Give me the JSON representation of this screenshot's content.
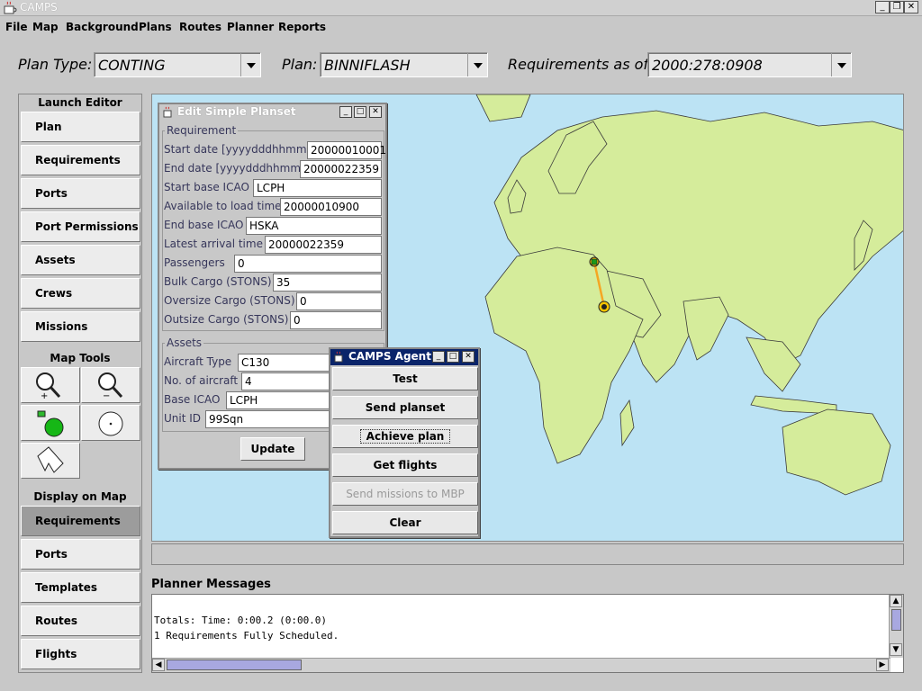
{
  "window": {
    "title": "CAMPS"
  },
  "menubar": {
    "items": [
      "File",
      "Map",
      "Background",
      "Plans",
      "Routes",
      "Planner",
      "Reports"
    ]
  },
  "selectors": {
    "plan_type": {
      "label": "Plan Type:",
      "value": "CONTING"
    },
    "plan": {
      "label": "Plan:",
      "value": "BINNIFLASH"
    },
    "requirements_as_of": {
      "label": "Requirements as of:",
      "value": "2000:278:0908"
    }
  },
  "left_panel": {
    "launch_editor": {
      "title": "Launch Editor",
      "items": [
        "Plan",
        "Requirements",
        "Ports",
        "Port Permissions",
        "Assets",
        "Crews",
        "Missions"
      ]
    },
    "map_tools": {
      "title": "Map Tools",
      "tools": [
        "zoom-in-icon",
        "zoom-out-icon",
        "add-point-icon",
        "center-point-icon",
        "polygon-select-icon"
      ]
    },
    "display_on_map": {
      "title": "Display on Map",
      "items": [
        "Requirements",
        "Ports",
        "Templates",
        "Routes",
        "Flights"
      ],
      "active": "Requirements"
    }
  },
  "planset_dialog": {
    "title": "Edit Simple Planset",
    "requirement_legend": "Requirement",
    "fields": [
      {
        "label": "Start date [yyyydddhhmm]",
        "value": "20000010001"
      },
      {
        "label": "End date [yyyydddhhmm]",
        "value": "20000022359"
      },
      {
        "label": "Start base ICAO",
        "value": "LCPH"
      },
      {
        "label": "Available to load time",
        "value": "20000010900"
      },
      {
        "label": "End base ICAO",
        "value": "HSKA"
      },
      {
        "label": "Latest arrival time",
        "value": "20000022359"
      },
      {
        "label": "Passengers",
        "value": "0"
      },
      {
        "label": "Bulk Cargo (STONS)",
        "value": "35"
      },
      {
        "label": "Oversize Cargo (STONS)",
        "value": "0"
      },
      {
        "label": "Outsize Cargo (STONS)",
        "value": "0"
      }
    ],
    "assets_legend": "Assets",
    "assets": [
      {
        "label": "Aircraft Type",
        "value": "C130"
      },
      {
        "label": "No. of aircraft",
        "value": "4"
      },
      {
        "label": "Base ICAO",
        "value": "LCPH"
      },
      {
        "label": "Unit ID",
        "value": "99Sqn"
      }
    ],
    "update_label": "Update"
  },
  "agent_dialog": {
    "title": "CAMPS Agent",
    "buttons": [
      "Test",
      "Send planset",
      "Achieve plan",
      "Get flights",
      "Send missions to MBP",
      "Clear"
    ]
  },
  "planner_messages": {
    "title": "Planner Messages",
    "lines": [
      "Totals: Time: 0:00.2 (0:00.0)",
      "1 Requirements Fully Scheduled."
    ]
  },
  "colors": {
    "land": "#d5ec9b",
    "sea": "#bce3f4",
    "route": "#f5a623",
    "start_marker": "#1a9a1a",
    "end_marker": "#f5c400"
  }
}
